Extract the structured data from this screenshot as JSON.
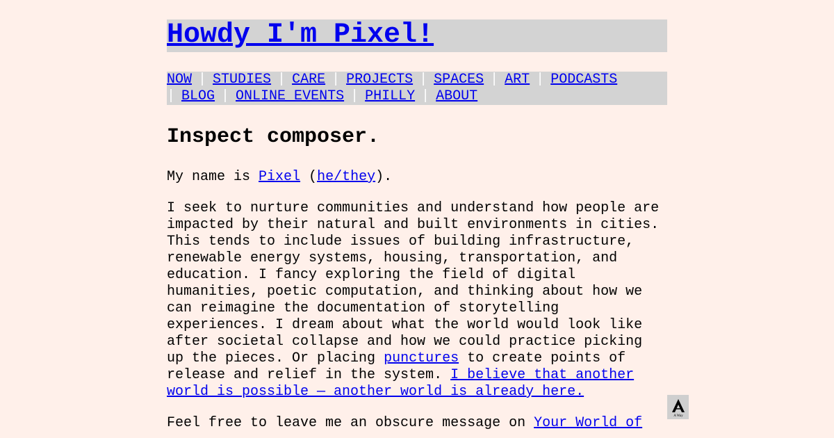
{
  "site": {
    "title": "Howdy I'm Pixel!"
  },
  "nav": {
    "items": [
      {
        "label": "NOW"
      },
      {
        "label": "STUDIES"
      },
      {
        "label": "CARE"
      },
      {
        "label": "PROJECTS"
      },
      {
        "label": "SPACES"
      },
      {
        "label": "ART"
      },
      {
        "label": "PODCASTS"
      },
      {
        "label": "BLOG"
      },
      {
        "label": "ONLINE EVENTS"
      },
      {
        "label": "PHILLY"
      },
      {
        "label": "ABOUT"
      }
    ],
    "separator": "|"
  },
  "main": {
    "heading": "Inspect composer.",
    "intro": {
      "prefix": "My name is ",
      "name_link": "Pixel",
      "paren_open": " (",
      "pronoun_link": "he/they",
      "paren_close": ")."
    },
    "bio": {
      "text": "I seek to nurture communities and understand how people are impacted by their natural and built environments in cities. This tends to include issues of building infrastructure, renewable energy systems, housing, transportation, and education. I fancy exploring the field of digital humanities, poetic computation, and thinking about how we can reimagine the documentation of storytelling experiences. I dream about what the world would look like after societal collapse and how we could practice picking up the pieces. Or placing ",
      "punctures_link": "punctures",
      "mid_text": " to create points of release and relief in the system. ",
      "world_link": "I believe that another world is possible — another world is already here."
    },
    "footer_line": {
      "prefix": "Feel free to leave me an obscure message on ",
      "link": "Your World of"
    }
  },
  "badge": {
    "icon": "aw-logo-icon",
    "text": "A Way"
  }
}
